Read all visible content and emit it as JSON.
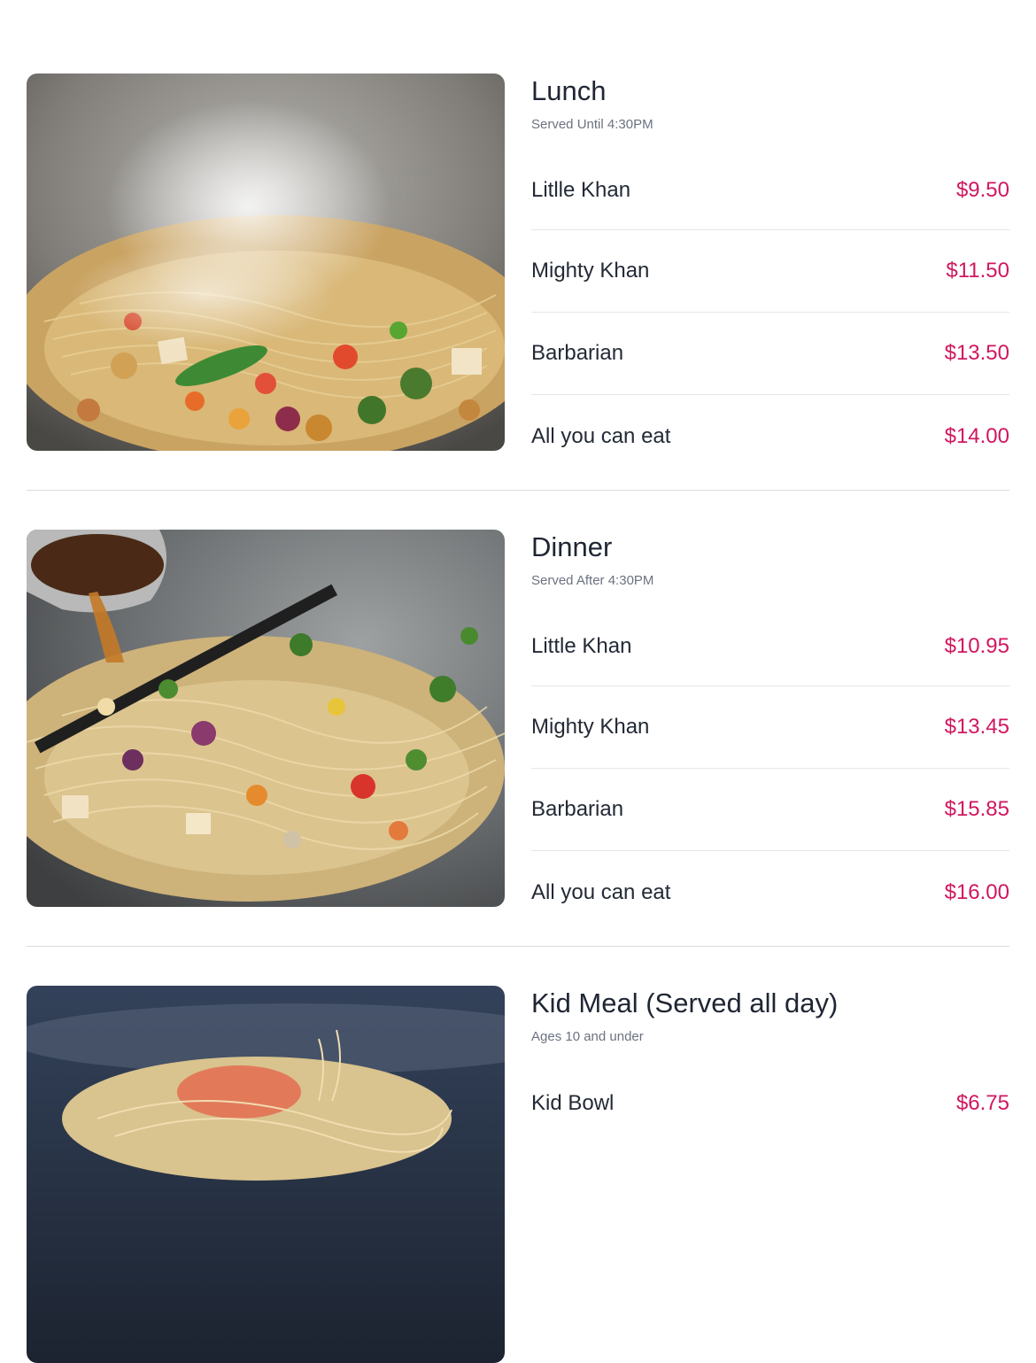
{
  "colors": {
    "price": "#d0175f",
    "title": "#1f2533",
    "subtitle": "#6b7280",
    "divider": "#d9dde2"
  },
  "sections": [
    {
      "title": "Lunch",
      "subtitle": "Served Until 4:30PM",
      "items": [
        {
          "name": "Litlle Khan",
          "price": "$9.50"
        },
        {
          "name": "Mighty Khan",
          "price": "$11.50"
        },
        {
          "name": "Barbarian",
          "price": "$13.50"
        },
        {
          "name": "All you can eat",
          "price": "$14.00"
        }
      ]
    },
    {
      "title": "Dinner",
      "subtitle": "Served After 4:30PM",
      "items": [
        {
          "name": "Little Khan",
          "price": "$10.95"
        },
        {
          "name": "Mighty Khan",
          "price": "$13.45"
        },
        {
          "name": "Barbarian",
          "price": "$15.85"
        },
        {
          "name": "All you can eat",
          "price": "$16.00"
        }
      ]
    },
    {
      "title": "Kid Meal (Served all day)",
      "subtitle": "Ages 10 and under",
      "items": [
        {
          "name": "Kid Bowl",
          "price": "$6.75"
        }
      ]
    }
  ]
}
